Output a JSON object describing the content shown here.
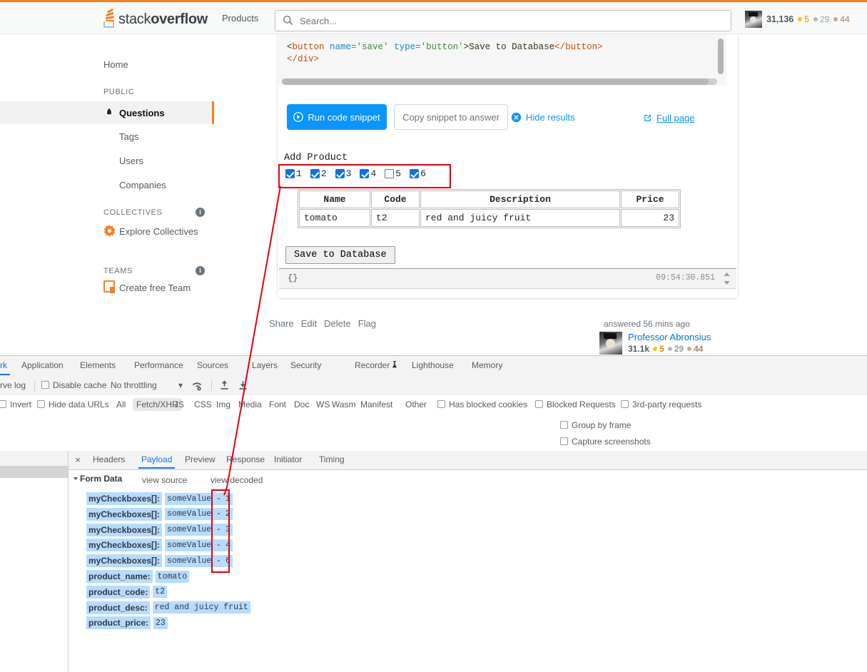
{
  "header": {
    "logo_stack": "stack",
    "logo_overflow": "overflow",
    "products": "Products",
    "search_placeholder": "Search...",
    "reputation": "31,136",
    "badges": {
      "gold": "5",
      "silver": "29",
      "bronze": "44"
    }
  },
  "sidebar": {
    "home": "Home",
    "public_header": "PUBLIC",
    "questions": "Questions",
    "tags": "Tags",
    "users": "Users",
    "companies": "Companies",
    "collectives_header": "COLLECTIVES",
    "explore_collectives": "Explore Collectives",
    "teams_header": "TEAMS",
    "create_free_team": "Create free Team"
  },
  "snippet": {
    "code_line1_a": "<",
    "code_line1_tag": "button",
    "code_line1_attr1": " name=",
    "code_line1_val1": "'save'",
    "code_line1_attr2": " type=",
    "code_line1_val2": "'button'",
    "code_line1_gt": ">",
    "code_line1_text": "Save to Database",
    "code_line1_close": "</button>",
    "code_line2": "</div>",
    "run_button": "Run code snippet",
    "copy_button": "Copy snippet to answer",
    "hide_results": "Hide results",
    "full_page": "Full page"
  },
  "result": {
    "title": "Add Product",
    "checkboxes": [
      {
        "label": "1",
        "checked": true
      },
      {
        "label": "2",
        "checked": true
      },
      {
        "label": "3",
        "checked": true
      },
      {
        "label": "4",
        "checked": true
      },
      {
        "label": "5",
        "checked": false
      },
      {
        "label": "6",
        "checked": true
      }
    ],
    "table_headers": [
      "Name",
      "Code",
      "Description",
      "Price"
    ],
    "table_row": {
      "name": "tomato",
      "code": "t2",
      "desc": "red and juicy fruit",
      "price": "23"
    },
    "save_button": "Save to Database",
    "console_value": "{}",
    "console_time": "09:54:30.851"
  },
  "post": {
    "share": "Share",
    "edit": "Edit",
    "delete": "Delete",
    "flag": "Flag",
    "answered": "answered 56 mins ago",
    "username": "Professor Abronsius",
    "user_rep": "31.1k",
    "user_badges": {
      "gold": "5",
      "silver": "29",
      "bronze": "44"
    }
  },
  "devtools": {
    "tabs": [
      {
        "label": "rk",
        "active": true
      },
      {
        "label": "Application",
        "active": false
      },
      {
        "label": "Elements",
        "active": false
      },
      {
        "label": "Performance",
        "active": false
      },
      {
        "label": "Sources",
        "active": false
      },
      {
        "label": "Layers",
        "active": false
      },
      {
        "label": "Security",
        "active": false
      },
      {
        "label": "Recorder",
        "active": false
      },
      {
        "label": "Lighthouse",
        "active": false
      },
      {
        "label": "Memory",
        "active": false
      }
    ],
    "toolbar": {
      "preserve_log": "rve log",
      "disable_cache": "Disable cache",
      "throttling": "No throttling"
    },
    "filters": {
      "invert": "Invert",
      "hide_data_urls": "Hide data URLs",
      "types": [
        "All",
        "Fetch/XHR",
        "JS",
        "CSS",
        "Img",
        "Media",
        "Font",
        "Doc",
        "WS",
        "Wasm",
        "Manifest",
        "Other"
      ],
      "selected_type": "Fetch/XHR",
      "has_blocked_cookies": "Has blocked cookies",
      "blocked_requests": "Blocked Requests",
      "third_party": "3rd-party requests"
    },
    "options": {
      "group_by_frame": "Group by frame",
      "capture_screenshots": "Capture screenshots"
    },
    "detail_tabs": [
      {
        "label": "Headers",
        "active": false
      },
      {
        "label": "Payload",
        "active": true
      },
      {
        "label": "Preview",
        "active": false
      },
      {
        "label": "Response",
        "active": false
      },
      {
        "label": "Initiator",
        "active": false
      },
      {
        "label": "Timing",
        "active": false
      }
    ],
    "close_icon": "×",
    "form_data_header": "Form Data",
    "view_source": "view source",
    "view_decoded": "view decoded",
    "form_data_rows": [
      {
        "key": "myCheckboxes[]:",
        "value": "someValue - ",
        "num": "1"
      },
      {
        "key": "myCheckboxes[]:",
        "value": "someValue - ",
        "num": "2"
      },
      {
        "key": "myCheckboxes[]:",
        "value": "someValue - ",
        "num": "3"
      },
      {
        "key": "myCheckboxes[]:",
        "value": "someValue - ",
        "num": "4"
      },
      {
        "key": "myCheckboxes[]:",
        "value": "someValue - ",
        "num": "6"
      },
      {
        "key": "product_name:",
        "value": "tomato",
        "num": ""
      },
      {
        "key": "product_code:",
        "value": "t2",
        "num": ""
      },
      {
        "key": "product_desc:",
        "value": "red and juicy fruit",
        "num": ""
      },
      {
        "key": "product_price:",
        "value": "23",
        "num": ""
      }
    ]
  },
  "annotation": {
    "color": "#e3000f"
  }
}
